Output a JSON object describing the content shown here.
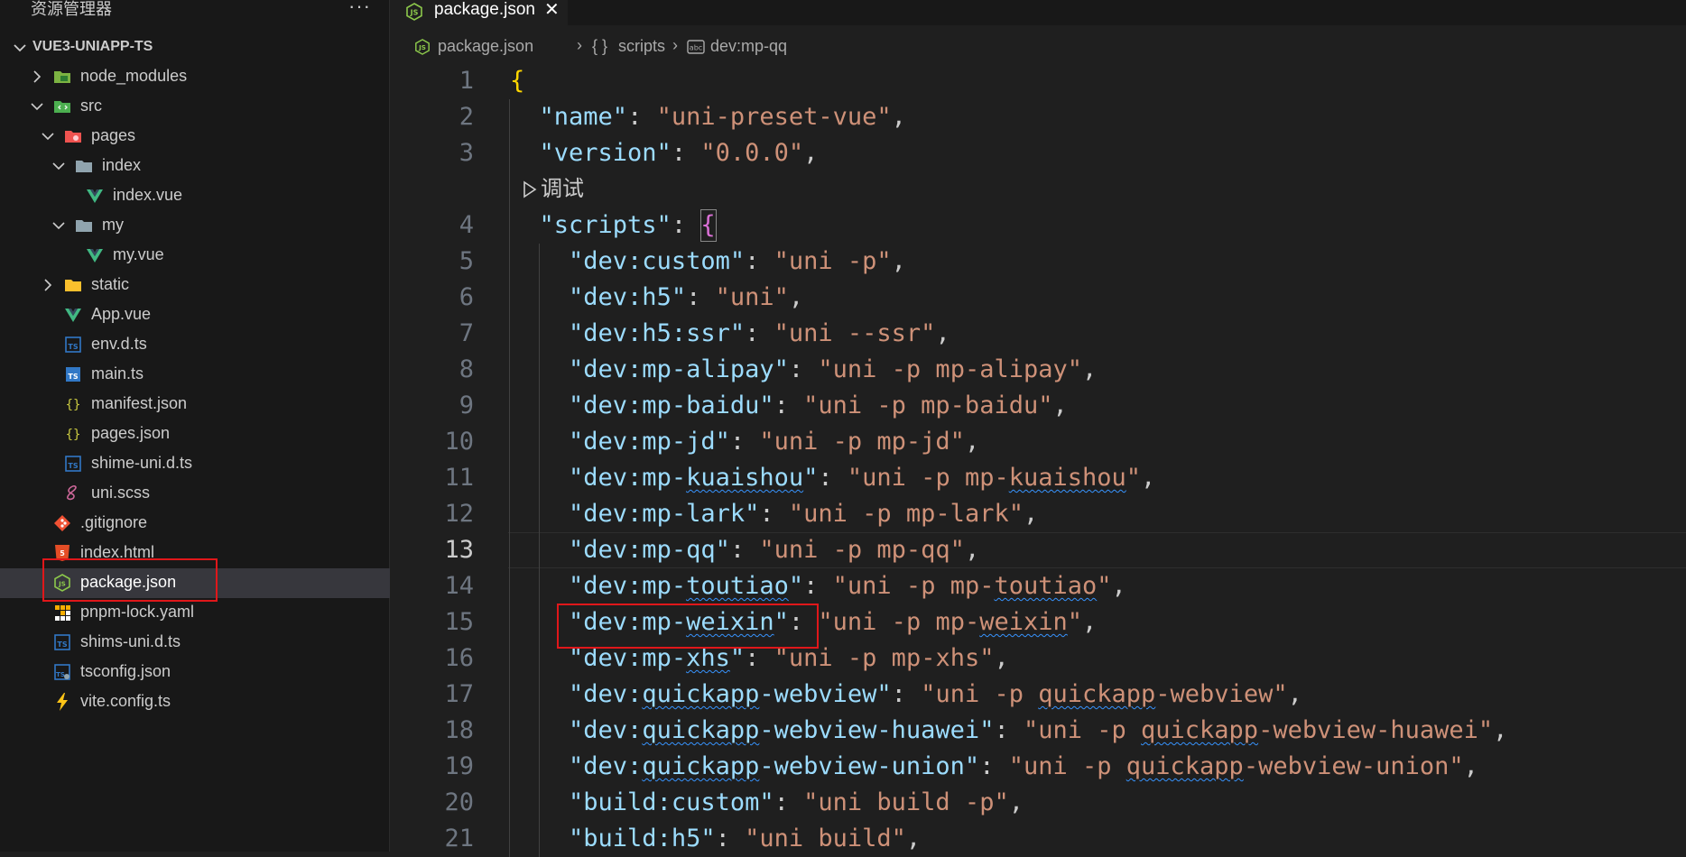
{
  "sidebar": {
    "title": "资源管理器",
    "more_icon": "···",
    "project_name": "VUE3-UNIAPP-TS",
    "items": [
      {
        "label": "node_modules",
        "depth": 0,
        "kind": "folder-node",
        "chevron": "right",
        "icon": "node-folder-icon"
      },
      {
        "label": "src",
        "depth": 0,
        "kind": "folder-src",
        "chevron": "down",
        "icon": "src-folder-icon"
      },
      {
        "label": "pages",
        "depth": 1,
        "kind": "folder-pages",
        "chevron": "down",
        "icon": "pages-folder-icon"
      },
      {
        "label": "index",
        "depth": 2,
        "kind": "folder",
        "chevron": "down",
        "icon": "folder-icon"
      },
      {
        "label": "index.vue",
        "depth": 3,
        "kind": "vue",
        "chevron": "",
        "icon": "vue-icon"
      },
      {
        "label": "my",
        "depth": 2,
        "kind": "folder",
        "chevron": "down",
        "icon": "folder-icon"
      },
      {
        "label": "my.vue",
        "depth": 3,
        "kind": "vue",
        "chevron": "",
        "icon": "vue-icon"
      },
      {
        "label": "static",
        "depth": 1,
        "kind": "folder-static",
        "chevron": "right",
        "icon": "static-folder-icon"
      },
      {
        "label": "App.vue",
        "depth": 1,
        "kind": "vue",
        "chevron": "",
        "icon": "vue-icon"
      },
      {
        "label": "env.d.ts",
        "depth": 1,
        "kind": "dts",
        "chevron": "",
        "icon": "typescript-def-icon"
      },
      {
        "label": "main.ts",
        "depth": 1,
        "kind": "ts",
        "chevron": "",
        "icon": "typescript-icon"
      },
      {
        "label": "manifest.json",
        "depth": 1,
        "kind": "json",
        "chevron": "",
        "icon": "json-braces-icon"
      },
      {
        "label": "pages.json",
        "depth": 1,
        "kind": "json",
        "chevron": "",
        "icon": "json-braces-icon"
      },
      {
        "label": "shime-uni.d.ts",
        "depth": 1,
        "kind": "dts",
        "chevron": "",
        "icon": "typescript-def-icon"
      },
      {
        "label": "uni.scss",
        "depth": 1,
        "kind": "scss",
        "chevron": "",
        "icon": "sass-icon"
      },
      {
        "label": ".gitignore",
        "depth": 0,
        "kind": "git",
        "chevron": "",
        "icon": "git-icon"
      },
      {
        "label": "index.html",
        "depth": 0,
        "kind": "html",
        "chevron": "",
        "icon": "html5-icon"
      },
      {
        "label": "package.json",
        "depth": 0,
        "kind": "npm",
        "chevron": "",
        "icon": "nodejs-icon",
        "selected": true
      },
      {
        "label": "pnpm-lock.yaml",
        "depth": 0,
        "kind": "pnpm",
        "chevron": "",
        "icon": "pnpm-icon"
      },
      {
        "label": "shims-uni.d.ts",
        "depth": 0,
        "kind": "dts",
        "chevron": "",
        "icon": "typescript-def-icon"
      },
      {
        "label": "tsconfig.json",
        "depth": 0,
        "kind": "tsconfig",
        "chevron": "",
        "icon": "tsconfig-icon"
      },
      {
        "label": "vite.config.ts",
        "depth": 0,
        "kind": "vite",
        "chevron": "",
        "icon": "vite-icon"
      }
    ]
  },
  "tab": {
    "label": "package.json",
    "icon": "nodejs-icon",
    "close": "✕"
  },
  "breadcrumb": {
    "file": "package.json",
    "section": "scripts",
    "section_icon": "{ }",
    "item": "dev:mp-qq",
    "item_icon": "string-icon",
    "separator": "›"
  },
  "codelens": "调试",
  "current_line": 13,
  "code_lines": [
    {
      "n": "1",
      "tokens": [
        [
          "b1",
          "{"
        ]
      ]
    },
    {
      "n": "2",
      "tokens": [
        [
          "p",
          "  "
        ],
        [
          "k",
          "\"name\""
        ],
        [
          "p",
          ": "
        ],
        [
          "s",
          "\"uni-preset-vue\""
        ],
        [
          "p",
          ","
        ]
      ]
    },
    {
      "n": "3",
      "tokens": [
        [
          "p",
          "  "
        ],
        [
          "k",
          "\"version\""
        ],
        [
          "p",
          ": "
        ],
        [
          "s",
          "\"0.0.0\""
        ],
        [
          "p",
          ","
        ]
      ]
    },
    {
      "n": "4",
      "tokens": [
        [
          "p",
          "  "
        ],
        [
          "k",
          "\"scripts\""
        ],
        [
          "p",
          ": "
        ],
        [
          "b2",
          "{"
        ]
      ]
    },
    {
      "n": "5",
      "tokens": [
        [
          "p",
          "    "
        ],
        [
          "k",
          "\"dev:custom\""
        ],
        [
          "p",
          ": "
        ],
        [
          "s",
          "\"uni -p\""
        ],
        [
          "p",
          ","
        ]
      ]
    },
    {
      "n": "6",
      "tokens": [
        [
          "p",
          "    "
        ],
        [
          "k",
          "\"dev:h5\""
        ],
        [
          "p",
          ": "
        ],
        [
          "s",
          "\"uni\""
        ],
        [
          "p",
          ","
        ]
      ]
    },
    {
      "n": "7",
      "tokens": [
        [
          "p",
          "    "
        ],
        [
          "k",
          "\"dev:h5:ssr\""
        ],
        [
          "p",
          ": "
        ],
        [
          "s",
          "\"uni --ssr\""
        ],
        [
          "p",
          ","
        ]
      ]
    },
    {
      "n": "8",
      "tokens": [
        [
          "p",
          "    "
        ],
        [
          "k",
          "\"dev:mp-alipay\""
        ],
        [
          "p",
          ": "
        ],
        [
          "s",
          "\"uni -p mp-alipay\""
        ],
        [
          "p",
          ","
        ]
      ]
    },
    {
      "n": "9",
      "tokens": [
        [
          "p",
          "    "
        ],
        [
          "k",
          "\"dev:mp-baidu\""
        ],
        [
          "p",
          ": "
        ],
        [
          "s",
          "\"uni -p mp-baidu\""
        ],
        [
          "p",
          ","
        ]
      ]
    },
    {
      "n": "10",
      "tokens": [
        [
          "p",
          "    "
        ],
        [
          "k",
          "\"dev:mp-jd\""
        ],
        [
          "p",
          ": "
        ],
        [
          "s",
          "\"uni -p mp-jd\""
        ],
        [
          "p",
          ","
        ]
      ]
    },
    {
      "n": "11",
      "tokens": [
        [
          "p",
          "    "
        ],
        [
          "k",
          "\"dev:mp-"
        ],
        [
          "k sq",
          "kuaishou"
        ],
        [
          "k",
          "\""
        ],
        [
          "p",
          ": "
        ],
        [
          "s",
          "\"uni -p mp-"
        ],
        [
          "s sq",
          "kuaishou"
        ],
        [
          "s",
          "\""
        ],
        [
          "p",
          ","
        ]
      ]
    },
    {
      "n": "12",
      "tokens": [
        [
          "p",
          "    "
        ],
        [
          "k",
          "\"dev:mp-lark\""
        ],
        [
          "p",
          ": "
        ],
        [
          "s",
          "\"uni -p mp-lark\""
        ],
        [
          "p",
          ","
        ]
      ]
    },
    {
      "n": "13",
      "tokens": [
        [
          "p",
          "    "
        ],
        [
          "k",
          "\"dev:mp-qq\""
        ],
        [
          "p",
          ": "
        ],
        [
          "s",
          "\"uni -p mp-qq\""
        ],
        [
          "p",
          ","
        ]
      ]
    },
    {
      "n": "14",
      "tokens": [
        [
          "p",
          "    "
        ],
        [
          "k",
          "\"dev:mp-"
        ],
        [
          "k sq",
          "toutiao"
        ],
        [
          "k",
          "\""
        ],
        [
          "p",
          ": "
        ],
        [
          "s",
          "\"uni -p mp-"
        ],
        [
          "s sq",
          "toutiao"
        ],
        [
          "s",
          "\""
        ],
        [
          "p",
          ","
        ]
      ]
    },
    {
      "n": "15",
      "tokens": [
        [
          "p",
          "    "
        ],
        [
          "k",
          "\"dev:mp-"
        ],
        [
          "k sq",
          "weixin"
        ],
        [
          "k",
          "\""
        ],
        [
          "p",
          ": "
        ],
        [
          "s",
          "\"uni -p mp-"
        ],
        [
          "s sq",
          "weixin"
        ],
        [
          "s",
          "\""
        ],
        [
          "p",
          ","
        ]
      ]
    },
    {
      "n": "16",
      "tokens": [
        [
          "p",
          "    "
        ],
        [
          "k",
          "\"dev:mp-"
        ],
        [
          "k sq",
          "xhs"
        ],
        [
          "k",
          "\""
        ],
        [
          "p",
          ": "
        ],
        [
          "s",
          "\"uni -p mp-xhs\""
        ],
        [
          "p",
          ","
        ]
      ]
    },
    {
      "n": "17",
      "tokens": [
        [
          "p",
          "    "
        ],
        [
          "k",
          "\"dev:"
        ],
        [
          "k sq",
          "quickapp"
        ],
        [
          "k",
          "-webview\""
        ],
        [
          "p",
          ": "
        ],
        [
          "s",
          "\"uni -p "
        ],
        [
          "s sq",
          "quickapp"
        ],
        [
          "s",
          "-webview\""
        ],
        [
          "p",
          ","
        ]
      ]
    },
    {
      "n": "18",
      "tokens": [
        [
          "p",
          "    "
        ],
        [
          "k",
          "\"dev:"
        ],
        [
          "k sq",
          "quickapp"
        ],
        [
          "k",
          "-webview-huawei\""
        ],
        [
          "p",
          ": "
        ],
        [
          "s",
          "\"uni -p "
        ],
        [
          "s sq",
          "quickapp"
        ],
        [
          "s",
          "-webview-huawei\""
        ],
        [
          "p",
          ","
        ]
      ]
    },
    {
      "n": "19",
      "tokens": [
        [
          "p",
          "    "
        ],
        [
          "k",
          "\"dev:"
        ],
        [
          "k sq",
          "quickapp"
        ],
        [
          "k",
          "-webview-union\""
        ],
        [
          "p",
          ": "
        ],
        [
          "s",
          "\"uni -p "
        ],
        [
          "s sq",
          "quickapp"
        ],
        [
          "s",
          "-webview-union\""
        ],
        [
          "p",
          ","
        ]
      ]
    },
    {
      "n": "20",
      "tokens": [
        [
          "p",
          "    "
        ],
        [
          "k",
          "\"build:custom\""
        ],
        [
          "p",
          ": "
        ],
        [
          "s",
          "\"uni build -p\""
        ],
        [
          "p",
          ","
        ]
      ]
    },
    {
      "n": "21",
      "tokens": [
        [
          "p",
          "    "
        ],
        [
          "k",
          "\"build:h5\""
        ],
        [
          "p",
          ": "
        ],
        [
          "s",
          "\"uni build\""
        ],
        [
          "p",
          ","
        ]
      ]
    }
  ],
  "colors": {
    "key": "#9cdcfe",
    "string": "#ce9178",
    "bracket_level1": "#ffd700",
    "bracket_level2": "#da70d6",
    "highlight_box": "#e0171a",
    "vue_green": "#41b883",
    "ts_blue": "#3178c6",
    "json_yellow": "#cbcb41",
    "node_green": "#8cc84b"
  }
}
